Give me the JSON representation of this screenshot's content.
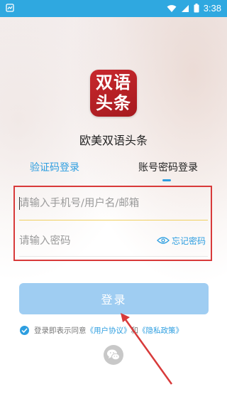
{
  "status_bar": {
    "time": "3:38",
    "icons": [
      "notification-icon",
      "wifi-icon",
      "signal-icon",
      "battery-icon"
    ]
  },
  "app": {
    "logo_line1": "双语",
    "logo_line2": "头条",
    "name": "欧美双语头条"
  },
  "tabs": [
    {
      "label": "验证码登录",
      "active": false
    },
    {
      "label": "账号密码登录",
      "active": true
    }
  ],
  "form": {
    "username_placeholder": "请输入手机号/用户名/邮箱",
    "username_value": "",
    "password_placeholder": "请输入密码",
    "password_value": "",
    "forgot_label": "忘记密码"
  },
  "login_button": "登录",
  "agreement": {
    "prefix": "登录即表示同意",
    "user_agreement": "《用户协议》",
    "and": "和",
    "privacy_policy": "《隐私政策》",
    "checked": true
  },
  "social": {
    "icon": "wechat-icon"
  },
  "colors": {
    "status_bar": "#2fa8e0",
    "accent": "#2d9ee0",
    "login_button": "#9fcdf2",
    "logo": "#b82025",
    "annotation": "#d83a3a"
  }
}
